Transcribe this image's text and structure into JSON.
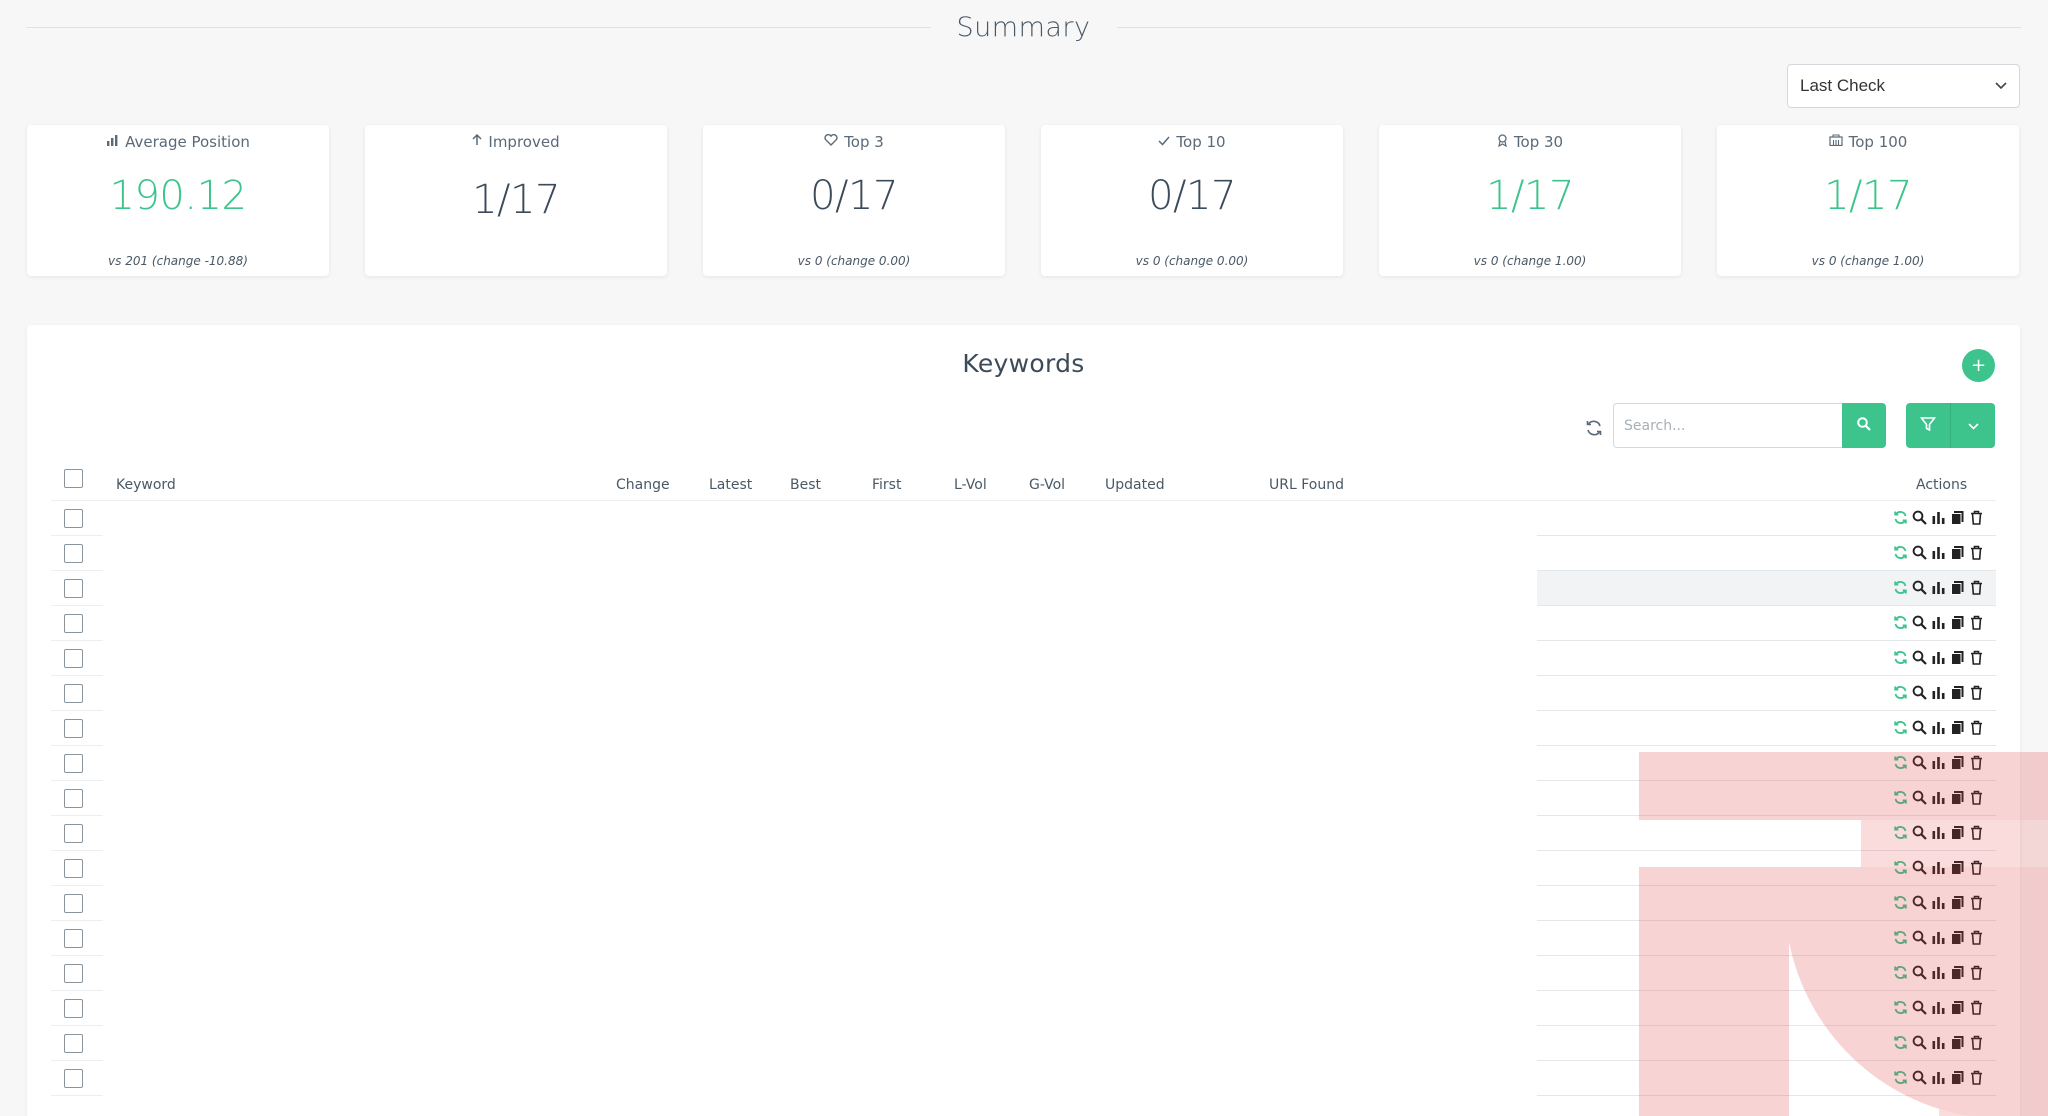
{
  "summary": {
    "title": "Summary",
    "period_select": {
      "value": "Last Check"
    }
  },
  "cards": [
    {
      "label": "Average Position",
      "icon": "bar-chart-icon",
      "value": "190.12",
      "compare": "vs 201 (change -10.88)",
      "highlight": true
    },
    {
      "label": "Improved",
      "icon": "arrow-up-icon",
      "value": "1/17",
      "compare": "",
      "highlight": false
    },
    {
      "label": "Top 3",
      "icon": "heart-icon",
      "value": "0/17",
      "compare": "vs 0 (change 0.00)",
      "highlight": false
    },
    {
      "label": "Top 10",
      "icon": "check-icon",
      "value": "0/17",
      "compare": "vs 0 (change 0.00)",
      "highlight": false
    },
    {
      "label": "Top 30",
      "icon": "award-icon",
      "value": "1/17",
      "compare": "vs 0 (change 1.00)",
      "highlight": true
    },
    {
      "label": "Top 100",
      "icon": "building-icon",
      "value": "1/17",
      "compare": "vs 0 (change 1.00)",
      "highlight": true
    }
  ],
  "keywords": {
    "title": "Keywords",
    "add_label": "+",
    "search": {
      "placeholder": "Search..."
    },
    "columns": [
      "Keyword",
      "Change",
      "Latest",
      "Best",
      "First",
      "L-Vol",
      "G-Vol",
      "Updated",
      "URL Found",
      "Actions"
    ],
    "row_count": 17,
    "row_actions": [
      "refresh-icon",
      "search-icon",
      "chart-icon",
      "copy-icon",
      "trash-icon"
    ]
  },
  "colors": {
    "accent": "#3cc48c",
    "text": "#3c4b5a",
    "background": "#f7f7f7"
  }
}
